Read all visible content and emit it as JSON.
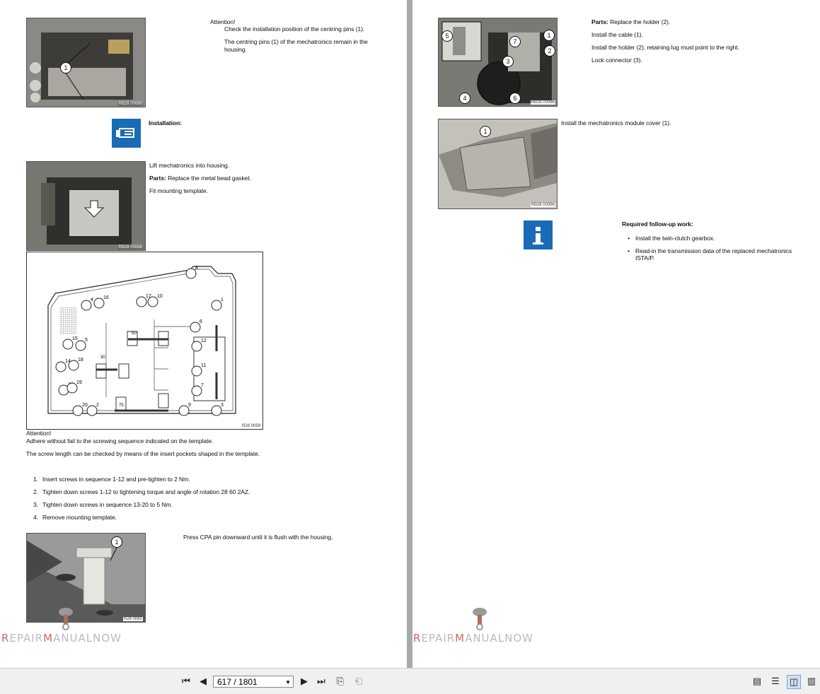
{
  "left_page": {
    "attention1_title": "Attention!",
    "attention1_line1": "Check the installation position of the centring pins (1).",
    "attention1_line2a": "The centring pins (1) of the mechatronics remain in the",
    "attention1_line2b": "housing.",
    "photo1_code": "RB28 00089",
    "installation_label": "Installation:",
    "step_lift": "Lift mechatronics into housing.",
    "parts_label": "Parts:",
    "step_parts": "Replace the metal bead gasket.",
    "step_fit": "Fit mounting template.",
    "photo2_code": "RB28 00088",
    "diagram_code": "R28 0059",
    "diagram_numbers": [
      "8",
      "1",
      "4",
      "16",
      "17",
      "10",
      "6",
      "5",
      "15",
      "12",
      "14",
      "18",
      "11",
      "13",
      "19",
      "7",
      "20",
      "2",
      "9",
      "3"
    ],
    "diagram_lengths": [
      "50",
      "30",
      "75"
    ],
    "attention2_title": "Attention!",
    "attention2_line1": "Adhere without fail to the screwing sequence indicated on the template.",
    "attention2_line2": "The screw length can be checked by means of the insert pockets shaped in the template.",
    "steps": [
      {
        "num": "1.",
        "text": "Insert screws in sequence 1-12 and pre-tighten to 2 Nm."
      },
      {
        "num": "2.",
        "text": "Tighten down screws 1-12 to tightening torque and angle of rotation 28 60 2AZ."
      },
      {
        "num": "3.",
        "text": "Tighten down screws in sequence 13-20 to 5 Nm."
      },
      {
        "num": "4.",
        "text": "Remove mounting template."
      }
    ],
    "press_cpa": "Press CPA pin downward until it is flush with the housing.",
    "photo3_code": "R28 0060",
    "callout": "1"
  },
  "right_page": {
    "photo4_code": "RB28 00086",
    "parts_label": "Parts:",
    "parts_text": "Replace the holder (2).",
    "install_cable": "Install the cable (1).",
    "install_holder": "Install the holder (2), retaining lug must point to the right.",
    "lock_connector": "Lock connector (3).",
    "callouts4": [
      "5",
      "7",
      "1",
      "2",
      "3",
      "4",
      "6"
    ],
    "install_cover": "Install the mechatronics module cover (1).",
    "photo5_code": "RB28 00066",
    "followup_title": "Required follow-up work:",
    "followup_items": [
      "Install the twin-clutch gearbox.",
      "Read-in the transmission data of the replaced mechatronics",
      "ISTA/P."
    ],
    "callout": "1"
  },
  "watermark": {
    "prefix": "R",
    "mid": "EPAIR",
    "accent": "M",
    "rest": "ANUALNOW"
  },
  "toolbar": {
    "page_indicator": "617 / 1801",
    "icons": [
      "first-page-icon",
      "prev-page-icon",
      "next-page-icon",
      "last-page-icon",
      "fit-page-icon",
      "fit-width-icon",
      "single-page-icon",
      "continuous-icon",
      "facing-icon",
      "continuous-facing-icon"
    ]
  },
  "colors": {
    "info_blue": "#1a6bb5",
    "page_bg": "#ffffff",
    "viewer_bg": "#a9a9a9"
  }
}
